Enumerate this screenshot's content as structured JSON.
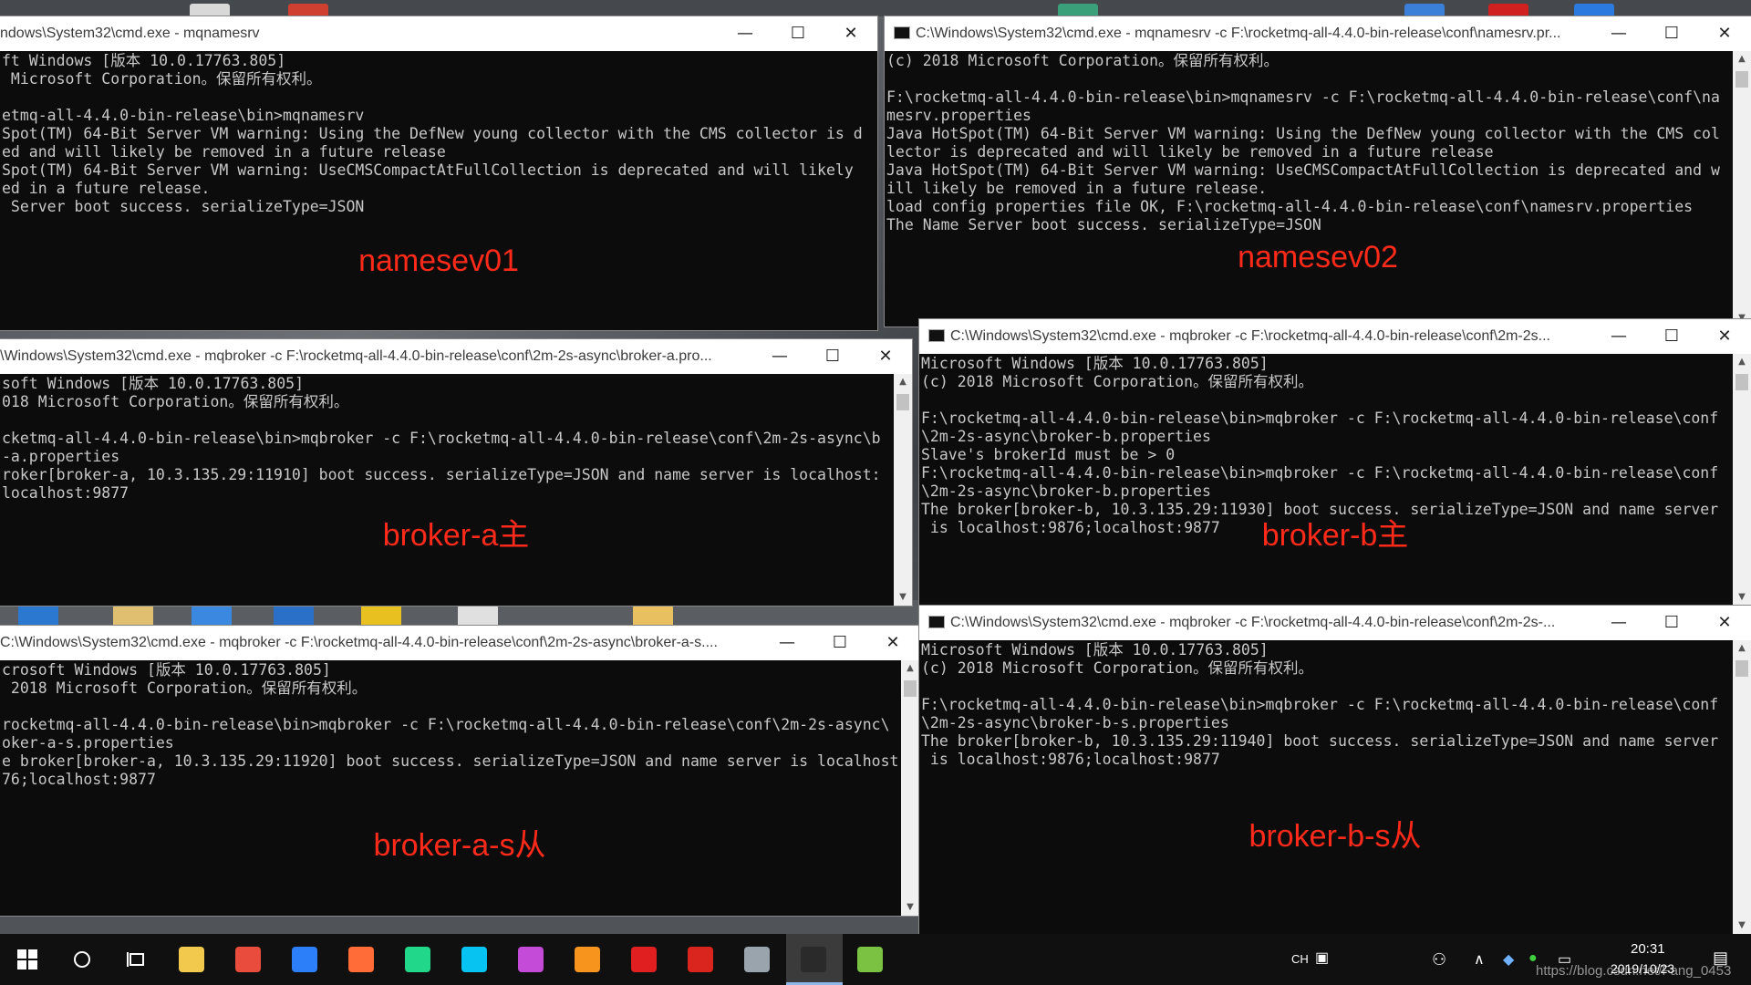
{
  "colors": {
    "label": "#ff2a1a",
    "console_bg": "#0c0c0c",
    "console_fg": "#c8c8c8"
  },
  "windows": [
    {
      "id": "namesev01",
      "title": "ndows\\System32\\cmd.exe - mqnamesrv",
      "has_title_icon": false,
      "label": "namesev01",
      "has_scrollbar": false,
      "lines": [
        "ft Windows [版本 10.0.17763.805]",
        " Microsoft Corporation。保留所有权利。",
        "",
        "etmq-all-4.4.0-bin-release\\bin>mqnamesrv",
        "Spot(TM) 64-Bit Server VM warning: Using the DefNew young collector with the CMS collector is d",
        "ed and will likely be removed in a future release",
        "Spot(TM) 64-Bit Server VM warning: UseCMSCompactAtFullCollection is deprecated and will likely",
        "ed in a future release.",
        " Server boot success. serializeType=JSON"
      ]
    },
    {
      "id": "namesev02",
      "title": "C:\\Windows\\System32\\cmd.exe - mqnamesrv  -c F:\\rocketmq-all-4.4.0-bin-release\\conf\\namesrv.pr...",
      "has_title_icon": true,
      "label": "namesev02",
      "has_scrollbar": true,
      "lines": [
        "(c) 2018 Microsoft Corporation。保留所有权利。",
        "",
        "F:\\rocketmq-all-4.4.0-bin-release\\bin>mqnamesrv -c F:\\rocketmq-all-4.4.0-bin-release\\conf\\na",
        "mesrv.properties",
        "Java HotSpot(TM) 64-Bit Server VM warning: Using the DefNew young collector with the CMS col",
        "lector is deprecated and will likely be removed in a future release",
        "Java HotSpot(TM) 64-Bit Server VM warning: UseCMSCompactAtFullCollection is deprecated and w",
        "ill likely be removed in a future release.",
        "load config properties file OK, F:\\rocketmq-all-4.4.0-bin-release\\conf\\namesrv.properties",
        "The Name Server boot success. serializeType=JSON"
      ]
    },
    {
      "id": "broker-a",
      "title": "\\Windows\\System32\\cmd.exe - mqbroker  -c F:\\rocketmq-all-4.4.0-bin-release\\conf\\2m-2s-async\\broker-a.pro...",
      "has_title_icon": false,
      "label": "broker-a主",
      "has_scrollbar": true,
      "lines": [
        "soft Windows [版本 10.0.17763.805]",
        "018 Microsoft Corporation。保留所有权利。",
        "",
        "cketmq-all-4.4.0-bin-release\\bin>mqbroker -c F:\\rocketmq-all-4.4.0-bin-release\\conf\\2m-2s-async\\b",
        "-a.properties",
        "roker[broker-a, 10.3.135.29:11910] boot success. serializeType=JSON and name server is localhost:",
        "localhost:9877"
      ]
    },
    {
      "id": "broker-b",
      "title": "C:\\Windows\\System32\\cmd.exe - mqbroker  -c F:\\rocketmq-all-4.4.0-bin-release\\conf\\2m-2s...",
      "has_title_icon": true,
      "label": "broker-b主",
      "has_scrollbar": true,
      "lines": [
        "Microsoft Windows [版本 10.0.17763.805]",
        "(c) 2018 Microsoft Corporation。保留所有权利。",
        "",
        "F:\\rocketmq-all-4.4.0-bin-release\\bin>mqbroker -c F:\\rocketmq-all-4.4.0-bin-release\\conf",
        "\\2m-2s-async\\broker-b.properties",
        "Slave's brokerId must be > 0",
        "F:\\rocketmq-all-4.4.0-bin-release\\bin>mqbroker -c F:\\rocketmq-all-4.4.0-bin-release\\conf",
        "\\2m-2s-async\\broker-b.properties",
        "The broker[broker-b, 10.3.135.29:11930] boot success. serializeType=JSON and name server",
        " is localhost:9876;localhost:9877"
      ]
    },
    {
      "id": "broker-a-s",
      "title": "C:\\Windows\\System32\\cmd.exe - mqbroker  -c F:\\rocketmq-all-4.4.0-bin-release\\conf\\2m-2s-async\\broker-a-s....",
      "has_title_icon": false,
      "label": "broker-a-s从",
      "has_scrollbar": true,
      "lines": [
        "crosoft Windows [版本 10.0.17763.805]",
        " 2018 Microsoft Corporation。保留所有权利。",
        "",
        "rocketmq-all-4.4.0-bin-release\\bin>mqbroker -c F:\\rocketmq-all-4.4.0-bin-release\\conf\\2m-2s-async\\",
        "oker-a-s.properties",
        "e broker[broker-a, 10.3.135.29:11920] boot success. serializeType=JSON and name server is localhost",
        "76;localhost:9877"
      ]
    },
    {
      "id": "broker-b-s",
      "title": "C:\\Windows\\System32\\cmd.exe - mqbroker  -c F:\\rocketmq-all-4.4.0-bin-release\\conf\\2m-2s-...",
      "has_title_icon": true,
      "label": "broker-b-s从",
      "has_scrollbar": true,
      "lines": [
        "Microsoft Windows [版本 10.0.17763.805]",
        "(c) 2018 Microsoft Corporation。保留所有权利。",
        "",
        "F:\\rocketmq-all-4.4.0-bin-release\\bin>mqbroker -c F:\\rocketmq-all-4.4.0-bin-release\\conf",
        "\\2m-2s-async\\broker-b-s.properties",
        "The broker[broker-b, 10.3.135.29:11940] boot success. serializeType=JSON and name server",
        " is localhost:9876;localhost:9877"
      ]
    }
  ],
  "window_buttons": {
    "minimize": "—",
    "maximize": "☐",
    "close": "✕"
  },
  "taskbar": {
    "apps": [
      {
        "name": "file-explorer",
        "color": "#f2c94c"
      },
      {
        "name": "chrome",
        "color": "#e94b3c"
      },
      {
        "name": "notes-app",
        "color": "#2d7ff9"
      },
      {
        "name": "postman",
        "color": "#ff6c37"
      },
      {
        "name": "intellij-community",
        "color": "#21d789"
      },
      {
        "name": "webstorm",
        "color": "#07c3f2"
      },
      {
        "name": "intellij-idea",
        "color": "#c44ad8"
      },
      {
        "name": "paint-3d",
        "color": "#f7941d"
      },
      {
        "name": "youdao-dict",
        "color": "#e02020"
      },
      {
        "name": "netease-music",
        "color": "#d9251d"
      },
      {
        "name": "image-viewer",
        "color": "#9aa4ad"
      },
      {
        "name": "cmd",
        "color": "#2a2a2a"
      },
      {
        "name": "notepad-plus",
        "color": "#7cc242"
      }
    ],
    "ime": "CH",
    "time": "20:31",
    "date": "2019/10/23",
    "watermark": "https://blog.csdn.net/Fang_0453"
  }
}
